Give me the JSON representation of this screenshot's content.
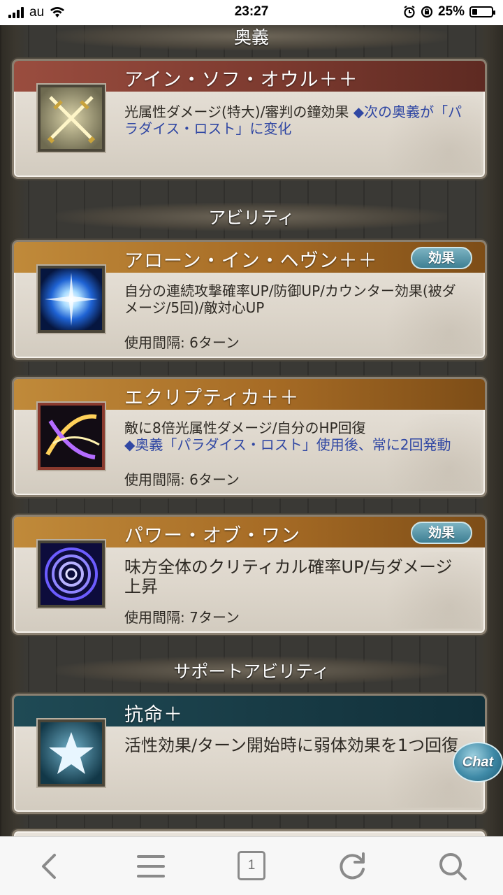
{
  "status_bar": {
    "carrier": "au",
    "time": "23:27",
    "battery_percent": "25%",
    "battery_level": 0.25
  },
  "sections": {
    "ougi": "奥義",
    "abilities": "アビリティ",
    "support": "サポートアビリティ"
  },
  "ougi_card": {
    "name": "アイン・ソフ・オウル＋＋",
    "desc": "光属性ダメージ(特大)/審判の鐘効果 ",
    "desc_blue": "◆次の奥義が「パラダイス・ロスト」に変化",
    "icon": "crossed-swords-icon"
  },
  "abilities": [
    {
      "name": "アローン・イン・ヘヴン＋＋",
      "effect_label": "効果",
      "desc": "自分の連続攻撃確率UP/防御UP/カウンター効果(被ダメージ/5回)/敵対心UP",
      "cooldown": "使用間隔: 6ターン",
      "icon": "light-burst-icon"
    },
    {
      "name": "エクリプティカ＋＋",
      "desc": "敵に8倍光属性ダメージ/自分のHP回復",
      "desc_blue": "◆奥義「パラダイス・ロスト」使用後、常に2回発動",
      "cooldown": "使用間隔: 6ターン",
      "icon": "slash-arc-icon"
    },
    {
      "name": "パワー・オブ・ワン",
      "effect_label": "効果",
      "desc": "味方全体のクリティカル確率UP/与ダメージ上昇",
      "cooldown": "使用間隔: 7ターン",
      "icon": "spiral-icon"
    }
  ],
  "support_card": {
    "name": "抗命＋",
    "desc": "活性効果/ターン開始時に弱体効果を1つ回復",
    "icon": "star-icon"
  },
  "chat_label": "Chat",
  "toolbar": {
    "tab_count": "1"
  },
  "colors": {
    "ougi_bar": "#7c3a2f",
    "ability_bar": "#a66b25",
    "support_bar": "#183b45",
    "blue_text": "#3047a3"
  }
}
